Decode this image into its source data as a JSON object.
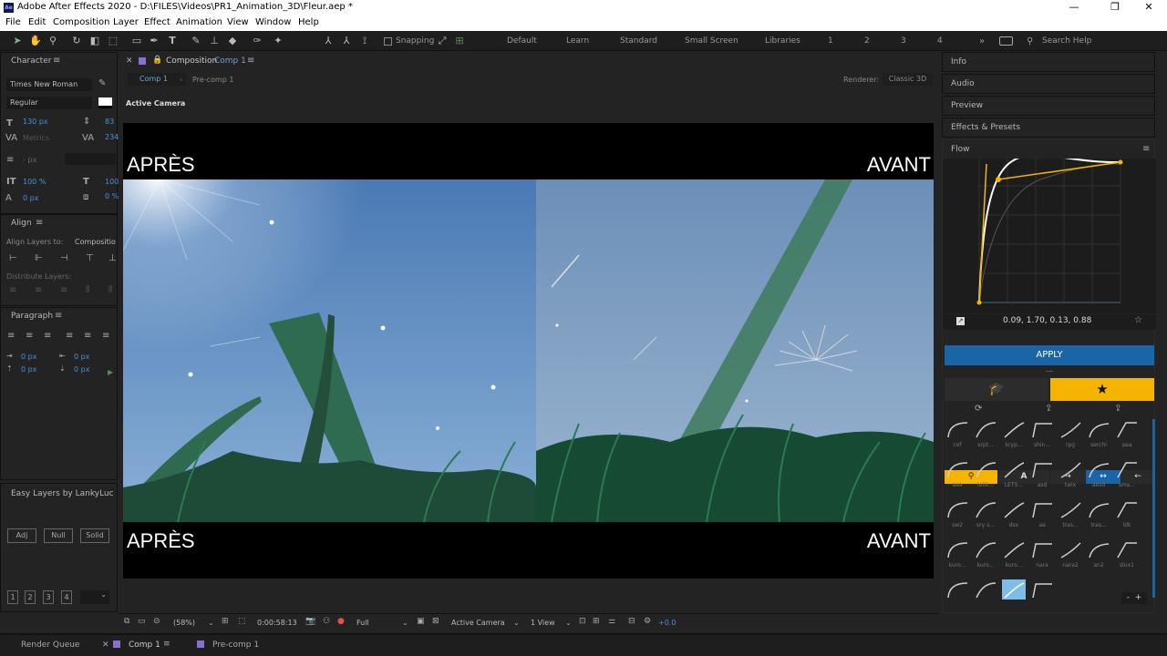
{
  "window": {
    "title": "Adobe After Effects 2020 - D:\\FILES\\Videos\\PR1_Animation_3D\\Fleur.aep *",
    "app_badge": "Ae"
  },
  "menu": [
    "File",
    "Edit",
    "Composition",
    "Layer",
    "Effect",
    "Animation",
    "View",
    "Window",
    "Help"
  ],
  "toolbar": {
    "snapping": "Snapping",
    "workspaces": [
      "Default",
      "Learn",
      "Standard",
      "Small Screen",
      "Libraries",
      "1",
      "2",
      "3",
      "4"
    ],
    "search_placeholder": "Search Help"
  },
  "character": {
    "header": "Character",
    "font": "Times New Roman",
    "style": "Regular",
    "size": "130 px",
    "leading": "83",
    "kerning": "Metrics",
    "tracking": "234",
    "stroke": "- px",
    "vscale": "100 %",
    "hscale": "100",
    "baseline": "0 px",
    "tsume": "0 %"
  },
  "align": {
    "header": "Align",
    "align_to_label": "Align Layers to:",
    "align_to_value": "Compositio",
    "distribute_label": "Distribute Layers:"
  },
  "paragraph": {
    "header": "Paragraph",
    "indent_left": "0 px",
    "indent_right": "0 px",
    "space_before": "0 px",
    "space_after": "0 px"
  },
  "easy_layers": {
    "header": "Easy Layers by LankyLuc",
    "buttons": [
      "Adj",
      "Null",
      "Solid"
    ],
    "numbers": [
      "1",
      "2",
      "3",
      "4"
    ]
  },
  "composition": {
    "panel_title": "Composition",
    "comp_name": "Comp 1",
    "breadcrumbs": [
      "Comp 1",
      "Pre-comp 1"
    ],
    "renderer_label": "Renderer:",
    "renderer_value": "Classic 3D",
    "active_camera": "Active Camera",
    "caption_left": "APRÈS",
    "caption_right": "AVANT"
  },
  "viewer_status": {
    "zoom": "(58%)",
    "timecode": "0:00:58:13",
    "resolution": "Full",
    "camera": "Active Camera",
    "views": "1 View",
    "exposure": "+0.0"
  },
  "right_panels": [
    "Info",
    "Audio",
    "Preview",
    "Effects & Presets"
  ],
  "flow": {
    "header": "Flow",
    "curve_values": "0.09, 1.70, 0.13, 0.88",
    "apply": "APPLY",
    "presets": [
      "cof",
      "srpt...",
      "kryp...",
      "shin...",
      "rpg",
      "serchi",
      "aaa",
      "aaa",
      "lelik...",
      "LETS...",
      "asd",
      "twix",
      "aesd",
      "sma...",
      "sw2",
      "sry s...",
      "dsx",
      "aa",
      "tras...",
      "tras...",
      "ldk",
      "kuro...",
      "kuro...",
      "kuro...",
      "nara",
      "nara2",
      "an2",
      "slux1",
      "",
      "",
      "",
      ""
    ],
    "accent": "#f5b400",
    "apply_color": "#1a64a8"
  },
  "bottom_tabs": [
    "Render Queue",
    "Comp 1",
    "Pre-comp 1"
  ]
}
